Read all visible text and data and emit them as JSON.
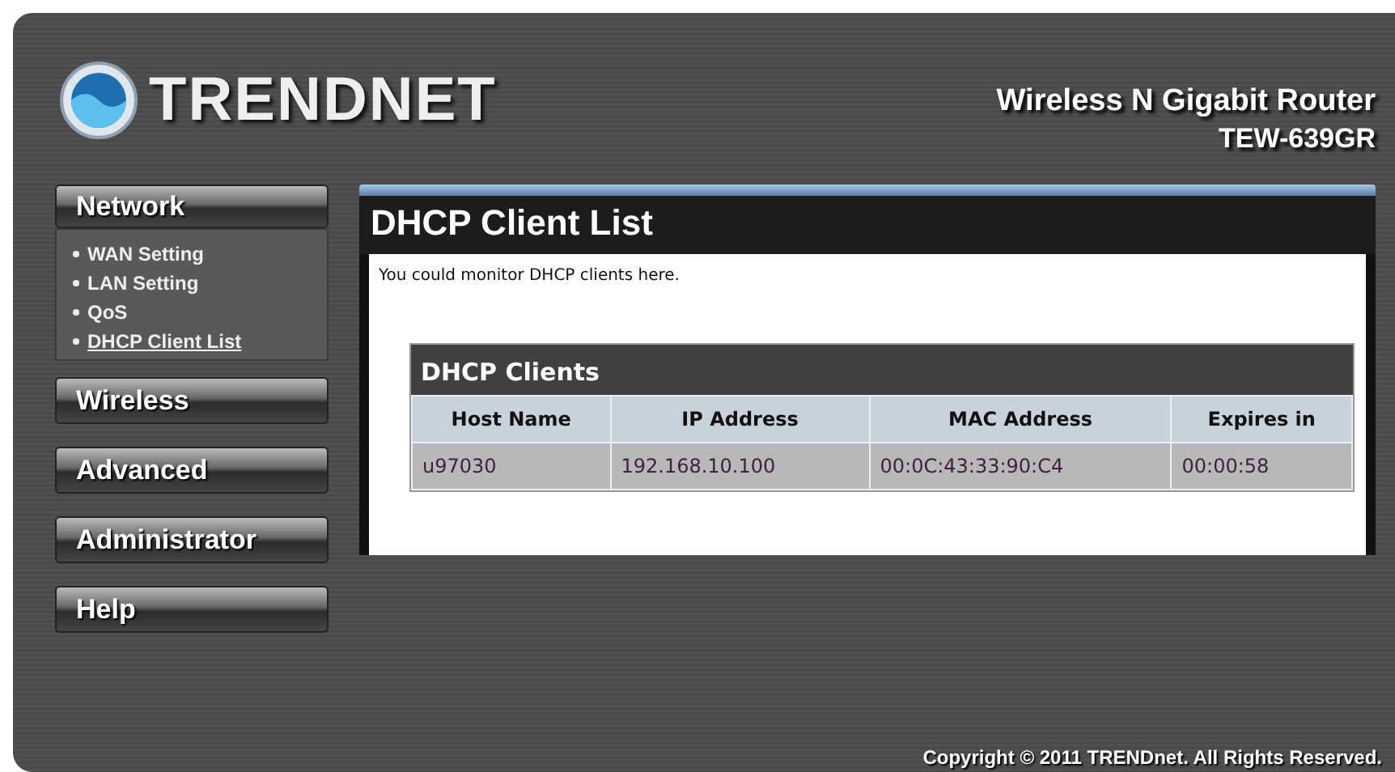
{
  "header": {
    "logo": "TRENDNET",
    "product": "Wireless N Gigabit Router",
    "model": "TEW-639GR"
  },
  "sidebar": {
    "groups": [
      {
        "label": "Network",
        "expanded": true,
        "items": [
          {
            "label": "WAN Setting",
            "selected": false
          },
          {
            "label": "LAN Setting",
            "selected": false
          },
          {
            "label": "QoS",
            "selected": false
          },
          {
            "label": "DHCP Client List",
            "selected": true
          }
        ]
      },
      {
        "label": "Wireless",
        "expanded": false
      },
      {
        "label": "Advanced",
        "expanded": false
      },
      {
        "label": "Administrator",
        "expanded": false
      },
      {
        "label": "Help",
        "expanded": false
      }
    ]
  },
  "page": {
    "title": "DHCP Client List",
    "description": "You could monitor DHCP clients here.",
    "table": {
      "title": "DHCP Clients",
      "columns": [
        "Host Name",
        "IP Address",
        "MAC Address",
        "Expires in"
      ],
      "rows": [
        [
          "u97030",
          "192.168.10.100",
          "00:0C:43:33:90:C4",
          "00:00:58"
        ]
      ]
    }
  },
  "footer": {
    "copyright": "Copyright © 2011 TRENDnet. All Rights Reserved."
  }
}
